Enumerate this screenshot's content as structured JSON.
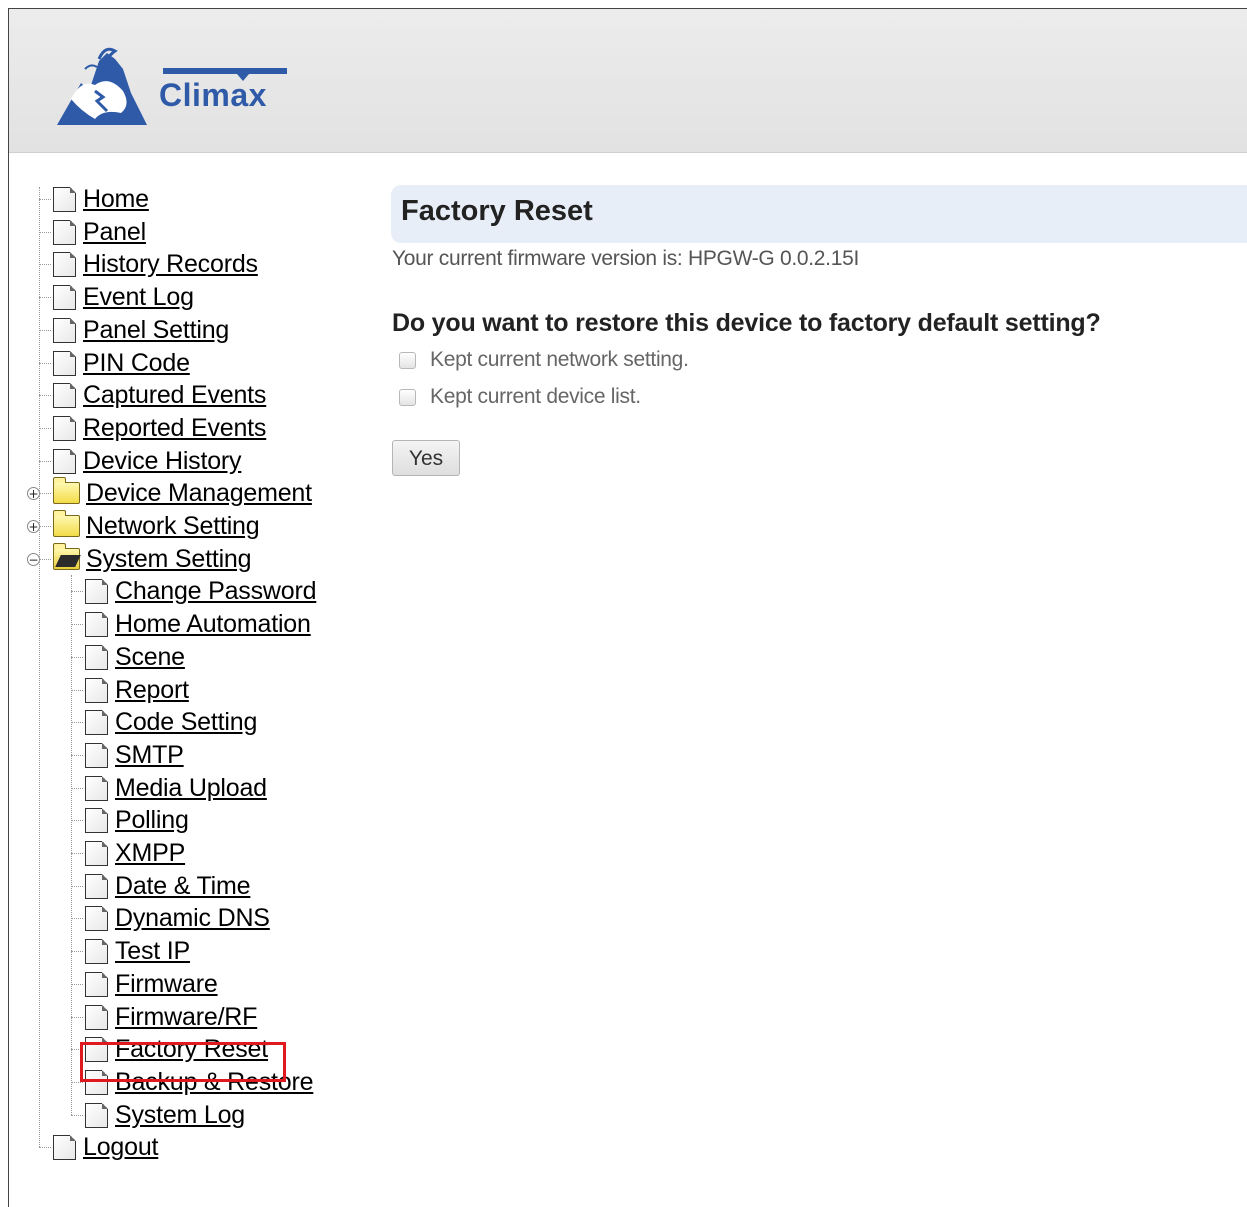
{
  "brand": {
    "name": "Climax",
    "color": "#2e5aa8"
  },
  "nav": {
    "items": [
      {
        "label": "Home",
        "type": "doc"
      },
      {
        "label": "Panel",
        "type": "doc"
      },
      {
        "label": "History Records",
        "type": "doc"
      },
      {
        "label": "Event Log",
        "type": "doc"
      },
      {
        "label": "Panel Setting",
        "type": "doc"
      },
      {
        "label": "PIN Code",
        "type": "doc"
      },
      {
        "label": "Captured Events",
        "type": "doc"
      },
      {
        "label": "Reported Events",
        "type": "doc"
      },
      {
        "label": "Device History",
        "type": "doc"
      },
      {
        "label": "Device Management",
        "type": "folder",
        "state": "collapsed"
      },
      {
        "label": "Network Setting",
        "type": "folder",
        "state": "collapsed"
      },
      {
        "label": "System Setting",
        "type": "folder",
        "state": "expanded"
      },
      {
        "label": "Logout",
        "type": "doc"
      }
    ],
    "system_children": [
      "Change Password",
      "Home Automation",
      "Scene",
      "Report",
      "Code Setting",
      "SMTP",
      "Media Upload",
      "Polling",
      "XMPP",
      "Date & Time",
      "Dynamic DNS",
      "Test IP",
      "Firmware",
      "Firmware/RF",
      "Factory Reset",
      "Backup & Restore",
      "System Log"
    ],
    "highlighted_item": "Factory Reset",
    "highlight_color": "#e0191f"
  },
  "main": {
    "title": "Factory Reset",
    "firmware_text": "Your current firmware version is: HPGW-G 0.0.2.15I",
    "question": "Do you want to restore this device to factory default setting?",
    "options": [
      {
        "label": "Kept current network setting.",
        "checked": false
      },
      {
        "label": "Kept current device list.",
        "checked": false
      }
    ],
    "yes_label": "Yes"
  }
}
